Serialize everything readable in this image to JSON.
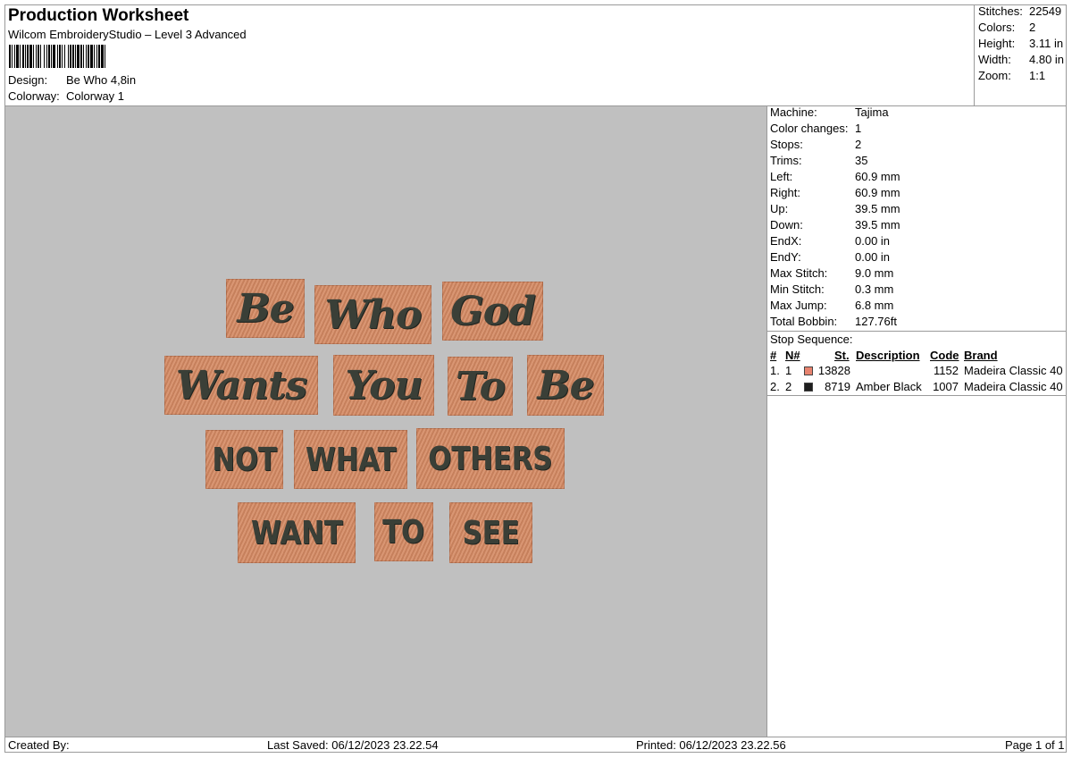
{
  "header": {
    "title": "Production Worksheet",
    "software": "Wilcom EmbroideryStudio – Level 3 Advanced",
    "design_label": "Design:",
    "design_value": "Be Who 4,8in",
    "colorway_label": "Colorway:",
    "colorway_value": "Colorway 1"
  },
  "summary": {
    "stitches_label": "Stitches:",
    "stitches_value": "22549",
    "colors_label": "Colors:",
    "colors_value": "2",
    "height_label": "Height:",
    "height_value": "3.11 in",
    "width_label": "Width:",
    "width_value": "4.80 in",
    "zoom_label": "Zoom:",
    "zoom_value": "1:1"
  },
  "machine_info": [
    {
      "label": "Machine:",
      "value": "Tajima"
    },
    {
      "label": "Color changes:",
      "value": "1"
    },
    {
      "label": "Stops:",
      "value": "2"
    },
    {
      "label": "Trims:",
      "value": "35"
    },
    {
      "label": "Left:",
      "value": "60.9 mm"
    },
    {
      "label": "Right:",
      "value": "60.9 mm"
    },
    {
      "label": "Up:",
      "value": "39.5 mm"
    },
    {
      "label": "Down:",
      "value": "39.5 mm"
    },
    {
      "label": "EndX:",
      "value": "0.00 in"
    },
    {
      "label": "EndY:",
      "value": "0.00 in"
    },
    {
      "label": "Max Stitch:",
      "value": "9.0 mm"
    },
    {
      "label": "Min Stitch:",
      "value": "0.3 mm"
    },
    {
      "label": "Max Jump:",
      "value": "6.8 mm"
    },
    {
      "label": "Total Bobbin:",
      "value": "127.76ft"
    }
  ],
  "stop_sequence": {
    "title": "Stop Sequence:",
    "headers": {
      "num": "#",
      "n": "N#",
      "st": "St.",
      "description": "Description",
      "code": "Code",
      "brand": "Brand"
    },
    "rows": [
      {
        "num": "1.",
        "n": "1",
        "color": "#e8836f",
        "st": "13828",
        "description": "",
        "code": "1152",
        "brand": "Madeira Classic 40"
      },
      {
        "num": "2.",
        "n": "2",
        "color": "#1e1e1e",
        "st": "8719",
        "description": "Amber Black",
        "code": "1007",
        "brand": "Madeira Classic 40"
      }
    ]
  },
  "design_words": [
    "Be",
    "Who",
    "God",
    "Wants",
    "You",
    "To",
    "Be",
    "NOT",
    "WHAT",
    "OTHERS",
    "WANT",
    "TO",
    "SEE"
  ],
  "footer": {
    "created_by": "Created By:",
    "last_saved": "Last Saved: 06/12/2023 23.22.54",
    "printed": "Printed: 06/12/2023 23.22.56",
    "page": "Page 1 of 1"
  }
}
